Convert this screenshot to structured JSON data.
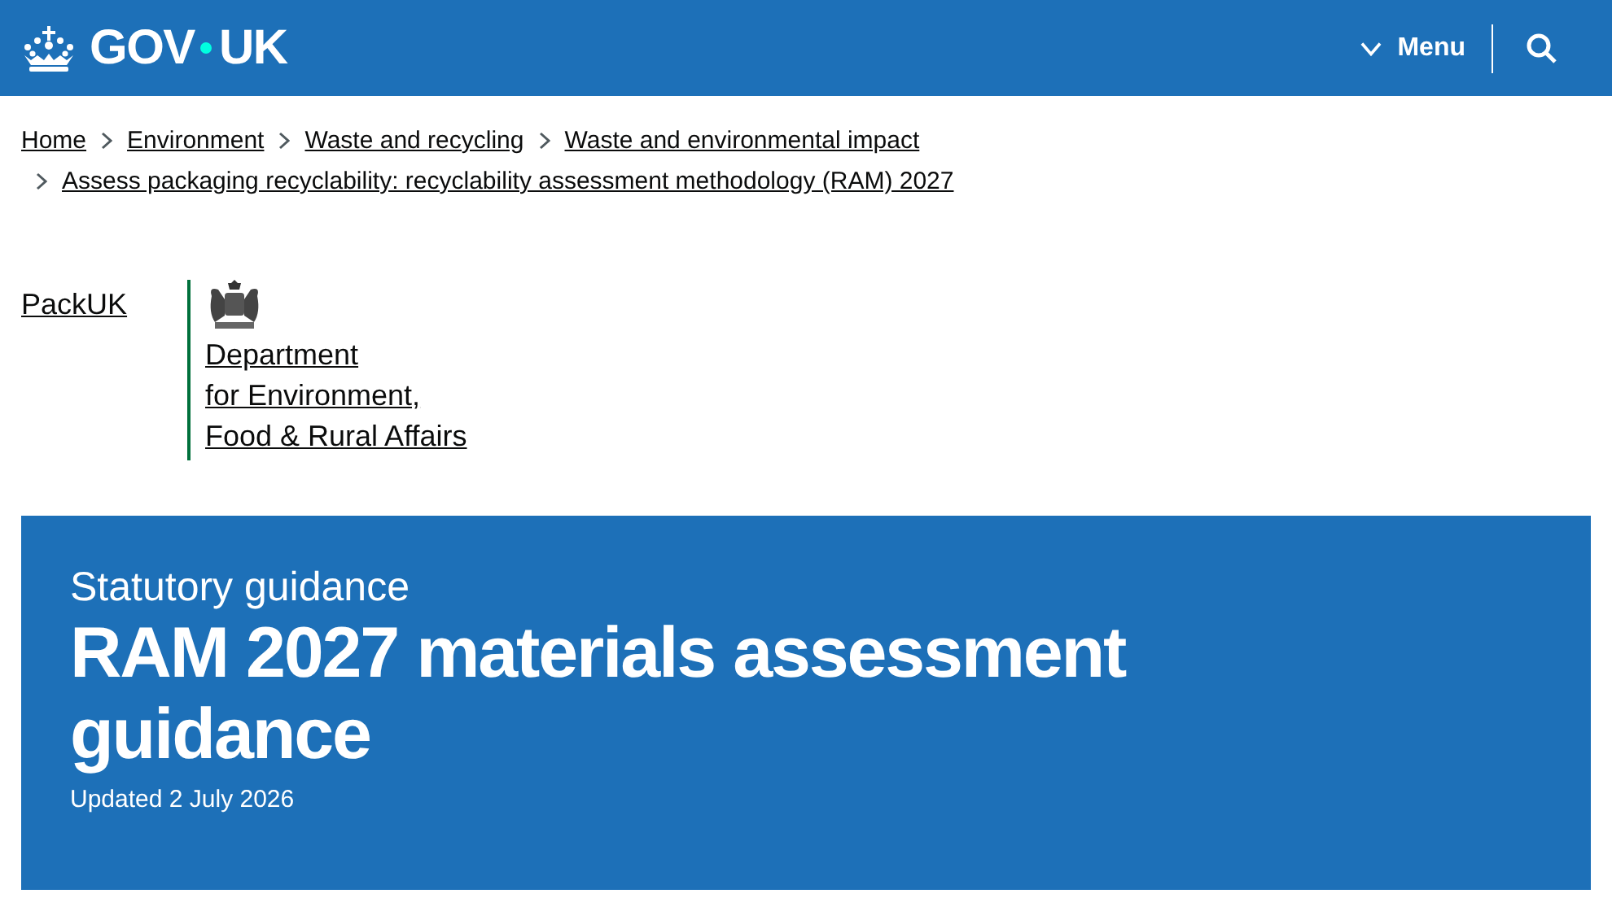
{
  "header": {
    "logo_parts": [
      "GOV",
      "UK"
    ],
    "menu": {
      "label": "Menu",
      "expanded": false
    }
  },
  "breadcrumbs": [
    {
      "label": "Home"
    },
    {
      "label": "Environment"
    },
    {
      "label": "Waste and recycling"
    },
    {
      "label": "Waste and environmental impact"
    },
    {
      "label": "Assess packaging recyclability: recyclability assessment methodology (RAM) 2027"
    }
  ],
  "organisations": {
    "first": "PackUK",
    "department": [
      "Department",
      "for Environment,",
      "Food & Rural Affairs"
    ]
  },
  "title_block": {
    "type": "Statutory guidance",
    "title": "RAM 2027 materials assessment guidance",
    "updated": "Updated 2 July 2026"
  }
}
